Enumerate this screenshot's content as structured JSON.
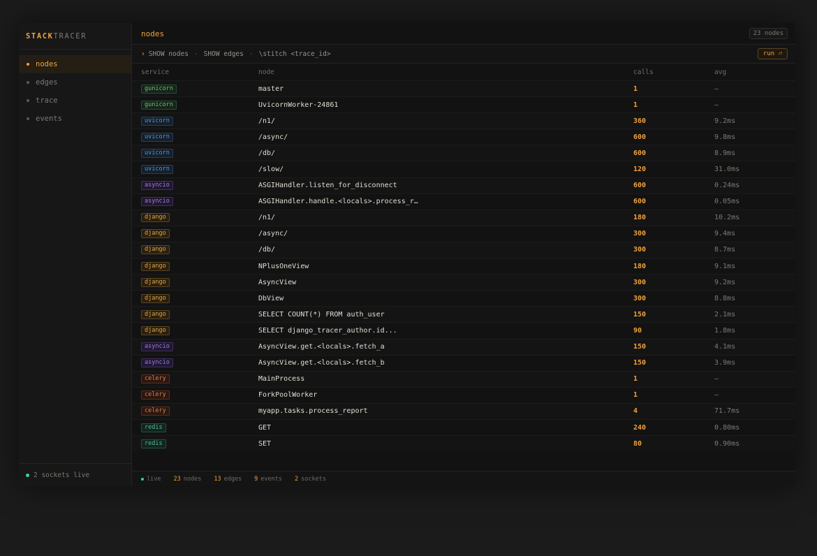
{
  "brand": {
    "part1": "STACK",
    "part2": "TRACER"
  },
  "sidebar": {
    "items": [
      {
        "label": "nodes",
        "active": true
      },
      {
        "label": "edges",
        "active": false
      },
      {
        "label": "trace",
        "active": false
      },
      {
        "label": "events",
        "active": false
      }
    ],
    "footer": "2 sockets live"
  },
  "header": {
    "title": "nodes",
    "count_badge": "23 nodes"
  },
  "query": {
    "prompt": "›",
    "cmd1": "SHOW nodes",
    "sep": "·",
    "cmd2": "SHOW edges",
    "cmd3": "\\stitch <trace_id>",
    "run_label": "run ⏎"
  },
  "table": {
    "columns": [
      "service",
      "node",
      "calls",
      "avg"
    ],
    "rows": [
      {
        "service": "gunicorn",
        "node": "master",
        "calls": "1",
        "avg": "—"
      },
      {
        "service": "gunicorn",
        "node": "UvicornWorker-24861",
        "calls": "1",
        "avg": "—"
      },
      {
        "service": "uvicorn",
        "node": "/n1/",
        "calls": "360",
        "avg": "9.2ms"
      },
      {
        "service": "uvicorn",
        "node": "/async/",
        "calls": "600",
        "avg": "9.8ms"
      },
      {
        "service": "uvicorn",
        "node": "/db/",
        "calls": "600",
        "avg": "8.9ms"
      },
      {
        "service": "uvicorn",
        "node": "/slow/",
        "calls": "120",
        "avg": "31.0ms"
      },
      {
        "service": "asyncio",
        "node": "ASGIHandler.listen_for_disconnect",
        "calls": "600",
        "avg": "0.24ms"
      },
      {
        "service": "asyncio",
        "node": "ASGIHandler.handle.<locals>.process_r…",
        "calls": "600",
        "avg": "0.05ms"
      },
      {
        "service": "django",
        "node": "/n1/",
        "calls": "180",
        "avg": "10.2ms"
      },
      {
        "service": "django",
        "node": "/async/",
        "calls": "300",
        "avg": "9.4ms"
      },
      {
        "service": "django",
        "node": "/db/",
        "calls": "300",
        "avg": "8.7ms"
      },
      {
        "service": "django",
        "node": "NPlusOneView",
        "calls": "180",
        "avg": "9.1ms"
      },
      {
        "service": "django",
        "node": "AsyncView",
        "calls": "300",
        "avg": "9.2ms"
      },
      {
        "service": "django",
        "node": "DbView",
        "calls": "300",
        "avg": "8.8ms"
      },
      {
        "service": "django",
        "node": "SELECT COUNT(*) FROM auth_user",
        "calls": "150",
        "avg": "2.1ms"
      },
      {
        "service": "django",
        "node": "SELECT django_tracer_author.id...",
        "calls": "90",
        "avg": "1.8ms"
      },
      {
        "service": "asyncio",
        "node": "AsyncView.get.<locals>.fetch_a",
        "calls": "150",
        "avg": "4.1ms"
      },
      {
        "service": "asyncio",
        "node": "AsyncView.get.<locals>.fetch_b",
        "calls": "150",
        "avg": "3.9ms"
      },
      {
        "service": "celery",
        "node": "MainProcess",
        "calls": "1",
        "avg": "—"
      },
      {
        "service": "celery",
        "node": "ForkPoolWorker",
        "calls": "1",
        "avg": "—"
      },
      {
        "service": "celery",
        "node": "myapp.tasks.process_report",
        "calls": "4",
        "avg": "71.7ms"
      },
      {
        "service": "redis",
        "node": "GET",
        "calls": "240",
        "avg": "0.80ms"
      },
      {
        "service": "redis",
        "node": "SET",
        "calls": "80",
        "avg": "0.90ms"
      }
    ]
  },
  "service_colors": {
    "gunicorn": {
      "fg": "#6fbf73",
      "bg": "#15241a",
      "border": "#2c4a31"
    },
    "uvicorn": {
      "fg": "#5d93c9",
      "bg": "#14202c",
      "border": "#263f57"
    },
    "asyncio": {
      "fg": "#a07ad8",
      "bg": "#1f1830",
      "border": "#3d2f5e"
    },
    "django": {
      "fg": "#e0a545",
      "bg": "#2a2010",
      "border": "#5a4420"
    },
    "celery": {
      "fg": "#e07a55",
      "bg": "#2a1710",
      "border": "#5a2e20"
    },
    "redis": {
      "fg": "#4fc08d",
      "bg": "#122420",
      "border": "#245040"
    }
  },
  "statusbar": {
    "live": "live",
    "nodes_num": "23",
    "nodes_label": "nodes",
    "edges_num": "13",
    "edges_label": "edges",
    "events_num": "9",
    "events_label": "events",
    "sockets_num": "2",
    "sockets_label": "sockets"
  }
}
